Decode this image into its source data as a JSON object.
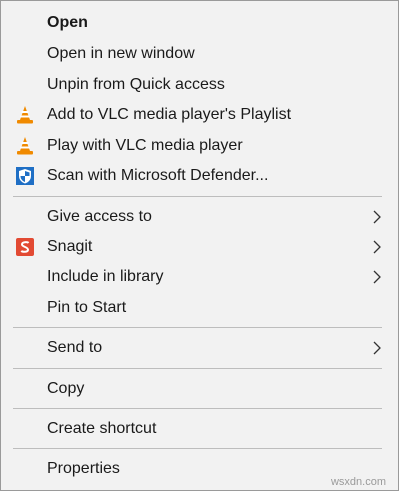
{
  "menu": {
    "open": "Open",
    "open_new_window": "Open in new window",
    "unpin_quick_access": "Unpin from Quick access",
    "vlc_add_playlist": "Add to VLC media player's Playlist",
    "vlc_play": "Play with VLC media player",
    "defender_scan": "Scan with Microsoft Defender...",
    "give_access": "Give access to",
    "snagit": "Snagit",
    "include_library": "Include in library",
    "pin_start": "Pin to Start",
    "send_to": "Send to",
    "copy": "Copy",
    "create_shortcut": "Create shortcut",
    "properties": "Properties"
  },
  "icons": {
    "vlc": "vlc-cone-icon",
    "defender": "shield-icon",
    "snagit": "snagit-icon",
    "submenu": "chevron-right-icon"
  },
  "colors": {
    "menu_bg": "#f2f2f2",
    "separator": "#bdbdbd",
    "vlc_orange": "#f08a00",
    "defender_blue": "#1f6fc5",
    "snagit_red": "#e24a33"
  },
  "watermark": "wsxdn.com"
}
